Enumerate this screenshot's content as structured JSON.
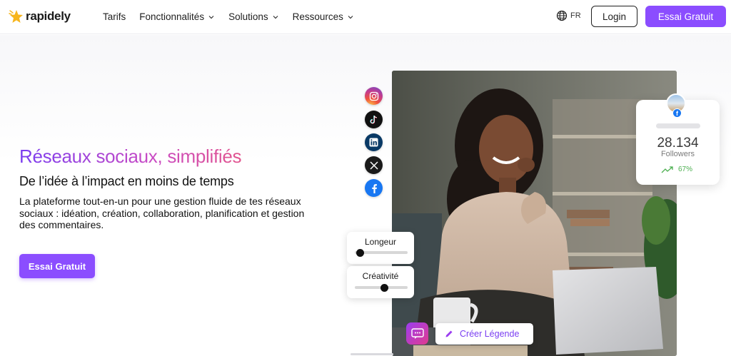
{
  "nav": {
    "logo_text": "rapidely",
    "links": [
      {
        "label": "Tarifs",
        "has_dropdown": false
      },
      {
        "label": "Fonctionnalités",
        "has_dropdown": true
      },
      {
        "label": "Solutions",
        "has_dropdown": true
      },
      {
        "label": "Ressources",
        "has_dropdown": true
      }
    ],
    "lang": "FR",
    "login_label": "Login",
    "cta_label": "Essai Gratuit"
  },
  "hero": {
    "headline": "Réseaux sociaux, simplifiés",
    "subhead": "De l’idée à l’impact en moins de temps",
    "description": "La plateforme tout-en-un pour une gestion fluide de tes réseaux sociaux : idéation, création, collaboration, planification et gestion des commentaires.",
    "cta_label": "Essai Gratuit"
  },
  "social_icons": [
    "instagram-icon",
    "tiktok-icon",
    "linkedin-icon",
    "x-icon",
    "facebook-icon"
  ],
  "followers_card": {
    "count": "28.134",
    "label": "Followers",
    "growth": "67%"
  },
  "sliders": [
    {
      "label": "Longeur",
      "value": 0.1
    },
    {
      "label": "Créativité",
      "value": 0.56
    }
  ],
  "caption_button": {
    "label": "Créer Légende"
  },
  "colors": {
    "brand": "#8b4dff",
    "gradient_start": "#7a3df0",
    "gradient_end": "#e2558e",
    "growth": "#4caf50"
  }
}
